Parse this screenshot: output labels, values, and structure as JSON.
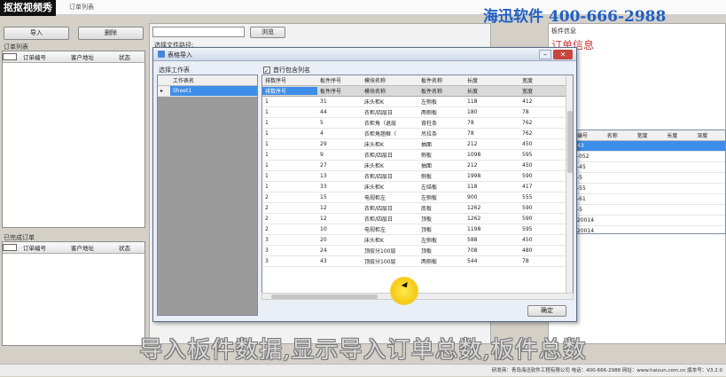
{
  "brand_tag": "抠抠视频秀",
  "app_title": "订单列表",
  "watermark": "海迅软件  400-666-2988",
  "toolbar": {
    "import_label": "导入",
    "delete_label": "删除"
  },
  "left_top": {
    "title": "订单列表",
    "columns": [
      "订单编号",
      "客户地址",
      "状态"
    ]
  },
  "left_bottom": {
    "title": "已完成订单",
    "columns": [
      "订单编号",
      "客户地址",
      "状态"
    ]
  },
  "middle": {
    "path_label": "选择文件路径:",
    "browse_label": "浏览"
  },
  "right": {
    "info_label": "板件信息",
    "order_hint": "订单信息",
    "columns": [
      "编号",
      "名称",
      "宽度",
      "长度",
      "深度"
    ],
    "rows": [
      "43",
      "-052",
      "-45",
      "-5",
      "-55",
      "-61",
      "-5",
      "20014",
      "20014"
    ]
  },
  "dialog": {
    "title": "表格导入",
    "sheet_header": "选择工作表",
    "sheet_col": "工作表名",
    "sheet_name": "Sheet1",
    "checkbox_label": "首行包含列名",
    "ok_label": "确定",
    "header1": [
      "排数序号",
      "板件序号",
      "模块名称",
      "板件名称",
      "长度",
      "宽度"
    ],
    "header2": [
      "排数序号",
      "板件序号",
      "模块名称",
      "板件名称",
      "长度",
      "宽度"
    ],
    "rows": [
      [
        "1",
        "31",
        "床头柜K",
        "左侧板",
        "118",
        "412"
      ],
      [
        "1",
        "44",
        "衣柜/四层日",
        "两侧板",
        "180",
        "78"
      ],
      [
        "1",
        "5",
        "衣柜角（退层",
        "背柱条",
        "78",
        "762"
      ],
      [
        "1",
        "4",
        "衣柜角翘框（",
        "吊拉条",
        "78",
        "762"
      ],
      [
        "1",
        "29",
        "床头柜K",
        "抽面",
        "212",
        "450"
      ],
      [
        "1",
        "9",
        "衣柜/四层日",
        "侧板",
        "1098",
        "595"
      ],
      [
        "1",
        "27",
        "床头柜K",
        "抽面",
        "212",
        "450"
      ],
      [
        "1",
        "13",
        "衣柜/四层日",
        "侧板",
        "1998",
        "590"
      ],
      [
        "1",
        "33",
        "床头柜K",
        "左结板",
        "118",
        "417"
      ],
      [
        "2",
        "15",
        "电视柜左",
        "左侧板",
        "900",
        "555"
      ],
      [
        "2",
        "12",
        "衣柜/四层日",
        "底板",
        "1262",
        "590"
      ],
      [
        "2",
        "12",
        "衣柜/四层日",
        "顶板",
        "1262",
        "590"
      ],
      [
        "2",
        "10",
        "电视柜左",
        "顶板",
        "1198",
        "595"
      ],
      [
        "3",
        "20",
        "床头柜K",
        "左侧板",
        "588",
        "450"
      ],
      [
        "3",
        "24",
        "顶层分100层",
        "顶板",
        "708",
        "480"
      ],
      [
        "3",
        "43",
        "顶层分100层",
        "两侧板",
        "544",
        "78"
      ]
    ]
  },
  "caption": "导入板件数据,显示导入订单总数,板件总数",
  "statusbar": "研发商：青岛海迅软件工程有限公司  电话：400-666-2988  网址：www.haixun.com.cn  版本号：V3.2.0"
}
